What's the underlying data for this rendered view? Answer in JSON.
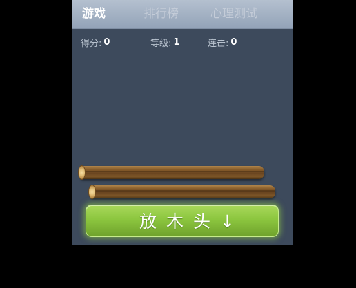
{
  "tabs": {
    "game": "游戏",
    "rank": "排行榜",
    "psych": "心理测试"
  },
  "stats": {
    "score_label": "得分:",
    "score_value": "0",
    "level_label": "等级:",
    "level_value": "1",
    "combo_label": "连击:",
    "combo_value": "0"
  },
  "logs": [
    "log",
    "log"
  ],
  "action_button": {
    "label": "放木头↓"
  },
  "colors": {
    "background": "#000000",
    "panel": "#3d4a5c",
    "button": "#8cc63f"
  }
}
